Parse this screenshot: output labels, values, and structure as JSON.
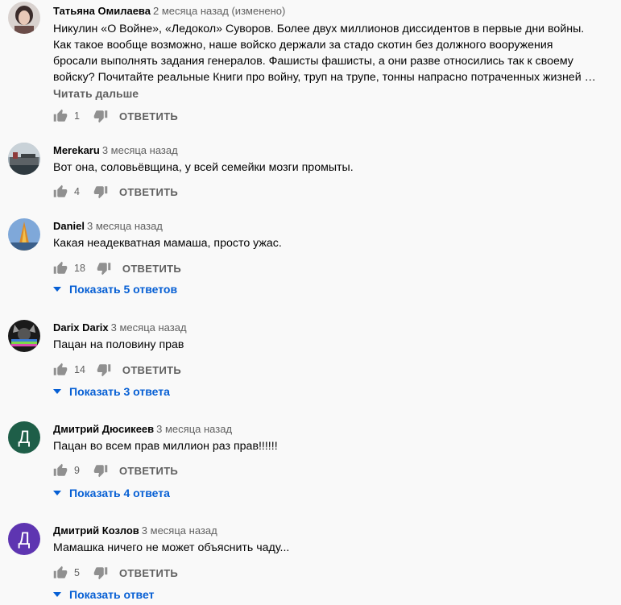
{
  "comments": [
    {
      "author": "Татьяна Омилаева",
      "date": "2 месяца назад (изменено)",
      "lines": [
        "Никулин «О Войне», «Ледокол» Суворов. Более двух миллионов диссидентов в первые дни войны.",
        "Как такое вообще возможно, наше войско держали за стадо скотин без должного вооружения",
        "бросали выполнять задания генералов. Фашисты фашисты, а они разве относились так к своему",
        "войску? Почитайте реальные Книги про войну, труп на трупе, тонны напрасно потраченных жизней …"
      ],
      "read_more": "Читать дальше",
      "likes": "1",
      "reply_label": "ОТВЕТИТЬ"
    },
    {
      "author": "Merekaru",
      "date": "3 месяца назад",
      "lines": [
        "Вот она, соловьёвщина, у всей семейки мозги промыты."
      ],
      "likes": "4",
      "reply_label": "ОТВЕТИТЬ"
    },
    {
      "author": "Daniel",
      "date": "3 месяца назад",
      "lines": [
        "Какая неадекватная мамаша, просто ужас."
      ],
      "likes": "18",
      "reply_label": "ОТВЕТИТЬ",
      "replies": "Показать 5 ответов"
    },
    {
      "author": "Darix Darix",
      "date": "3 месяца назад",
      "lines": [
        "Пацан на половину прав"
      ],
      "likes": "14",
      "reply_label": "ОТВЕТИТЬ",
      "replies": "Показать 3 ответа"
    },
    {
      "author": "Дмитрий Дюсикеев",
      "date": "3 месяца назад",
      "avatar_letter": "Д",
      "lines": [
        "Пацан во всем прав миллион раз прав!!!!!!"
      ],
      "likes": "9",
      "reply_label": "ОТВЕТИТЬ",
      "replies": "Показать 4 ответа"
    },
    {
      "author": "Дмитрий Козлов",
      "date": "3 месяца назад",
      "avatar_letter": "Д",
      "lines": [
        "Мамашка ничего не может объяснить чаду..."
      ],
      "likes": "5",
      "reply_label": "ОТВЕТИТЬ",
      "replies": "Показать ответ"
    }
  ],
  "colors": {
    "link_blue": "#065fd4",
    "muted": "#606060",
    "avatar_green": "#1e5e48",
    "avatar_purple": "#5e35b1"
  },
  "icons": {
    "like": "thumb-up-icon",
    "dislike": "thumb-down-icon",
    "replies": "chevron-down-icon"
  }
}
